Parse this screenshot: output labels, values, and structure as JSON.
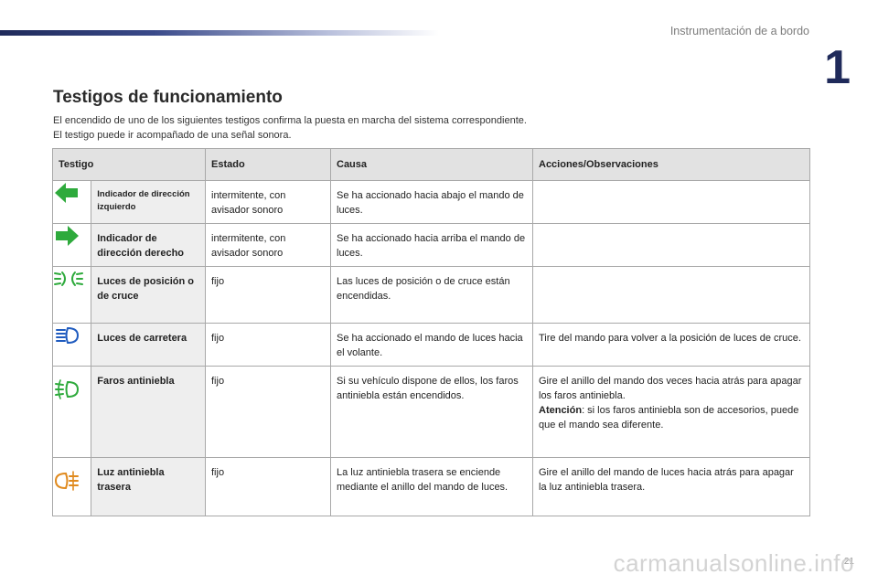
{
  "header": {
    "chapter_title": "Instrumentación de a bordo",
    "chapter_number": "1"
  },
  "title": "Testigos de funcionamiento",
  "intro": [
    "El encendido de uno de los siguientes testigos confirma la puesta en marcha del sistema correspondiente.",
    "El testigo puede ir acompañado de una señal sonora."
  ],
  "table": {
    "headers": [
      "Testigo",
      "Estado",
      "Causa",
      "Acciones/Observaciones"
    ],
    "rows": [
      {
        "icon": "left-turn-arrow-icon",
        "icon_color": "#2eaa3c",
        "name": "Indicador de dirección izquierdo",
        "state": "intermitente, con avisador sonoro",
        "cause": "Se ha accionado hacia abajo el mando de luces.",
        "action": ""
      },
      {
        "icon": "right-turn-arrow-icon",
        "icon_color": "#2eaa3c",
        "name": "Indicador de dirección derecho",
        "state": "intermitente, con avisador sonoro",
        "cause": "Se ha accionado hacia arriba el mando de luces.",
        "action": ""
      },
      {
        "icon": "position-low-beam-icon",
        "icon_color": "#2eaa3c",
        "name": "Luces de posición o de cruce",
        "state": "fijo",
        "cause": "Las luces de posición o de cruce están encendidas.",
        "action": ""
      },
      {
        "icon": "high-beam-icon",
        "icon_color": "#1f5bbf",
        "name": "Luces de carretera",
        "state": "fijo",
        "cause": "Se ha accionado el mando de luces hacia el volante.",
        "action": "Tire del mando para volver a la posición de luces de cruce."
      },
      {
        "icon": "front-fog-light-icon",
        "icon_color": "#2eaa3c",
        "name": "Faros antiniebla",
        "state": "fijo",
        "cause": "Si su vehículo dispone de ellos, los faros antiniebla están encendidos.",
        "action": "Gire el anillo del mando dos veces hacia atrás para apagar los faros antiniebla.",
        "note_label": "Atención",
        "note_text": ": si los faros antiniebla son de accesorios, puede que el mando sea diferente."
      },
      {
        "icon": "rear-fog-light-icon",
        "icon_color": "#e08a1e",
        "name": "Luz antiniebla trasera",
        "state": "fijo",
        "cause": "La luz antiniebla trasera se enciende mediante el anillo del mando de luces.",
        "action": "Gire el anillo del mando de luces hacia atrás para apagar la luz antiniebla trasera."
      }
    ]
  },
  "footer": {
    "page_number": "21",
    "watermark": "carmanualsonline.info"
  }
}
